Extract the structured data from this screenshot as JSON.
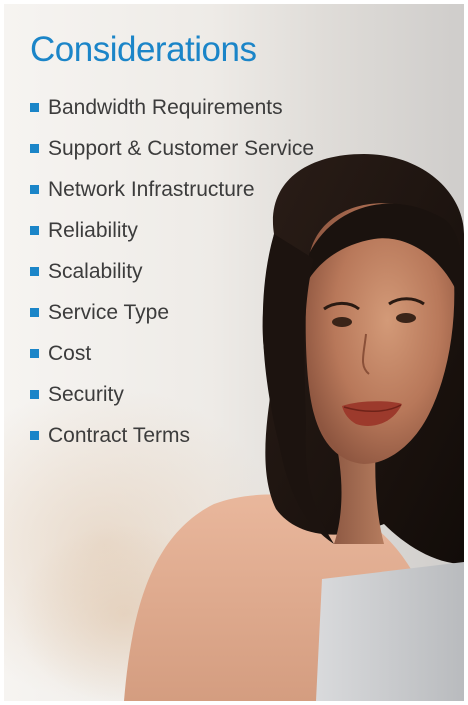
{
  "title": "Considerations",
  "items": [
    "Bandwidth Requirements",
    "Support & Customer Service",
    "Network Infrastructure",
    "Reliability",
    "Scalability",
    "Service Type",
    "Cost",
    "Security",
    "Contract Terms"
  ],
  "colors": {
    "accent": "#1b85c8",
    "text": "#3c3c3c"
  }
}
